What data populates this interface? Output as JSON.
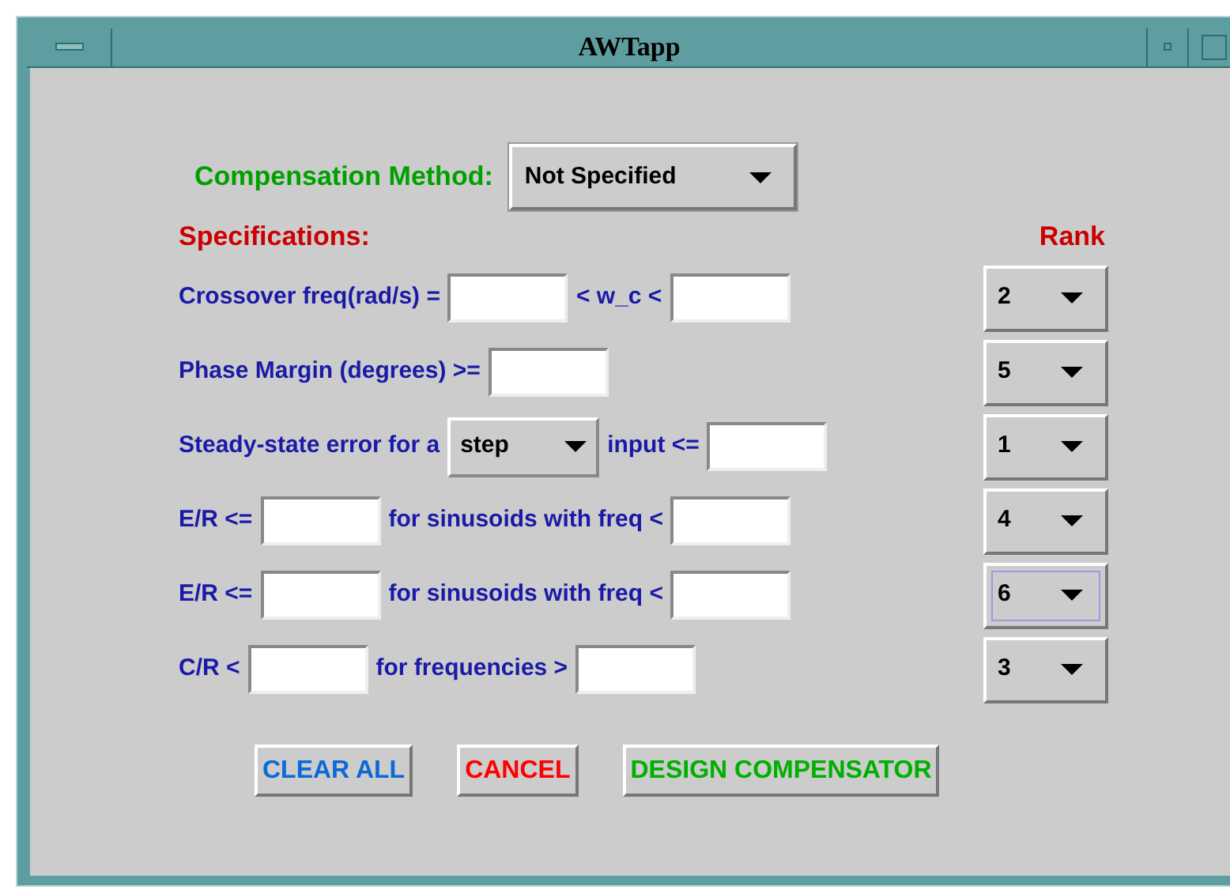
{
  "window": {
    "title": "AWTapp"
  },
  "compensation": {
    "label": "Compensation Method:",
    "value": "Not Specified"
  },
  "specifications_heading": "Specifications:",
  "rank_heading": "Rank",
  "rows": [
    {
      "parts": [
        {
          "kind": "text",
          "text": "Crossover freq(rad/s) ="
        },
        {
          "kind": "field"
        },
        {
          "kind": "text",
          "text": "< w_c <"
        },
        {
          "kind": "field"
        }
      ],
      "rank": {
        "value": "2",
        "focused": false
      }
    },
    {
      "parts": [
        {
          "kind": "text",
          "text": "Phase Margin (degrees) >="
        },
        {
          "kind": "field"
        }
      ],
      "rank": {
        "value": "5",
        "focused": false
      }
    },
    {
      "parts": [
        {
          "kind": "text",
          "text": "Steady-state error for a"
        },
        {
          "kind": "dropdown",
          "value": "step"
        },
        {
          "kind": "text",
          "text": "input <="
        },
        {
          "kind": "field"
        }
      ],
      "rank": {
        "value": "1",
        "focused": false
      }
    },
    {
      "parts": [
        {
          "kind": "text",
          "text": "E/R <="
        },
        {
          "kind": "field"
        },
        {
          "kind": "text",
          "text": "for sinusoids with freq <"
        },
        {
          "kind": "field"
        }
      ],
      "rank": {
        "value": "4",
        "focused": false
      }
    },
    {
      "parts": [
        {
          "kind": "text",
          "text": "E/R <="
        },
        {
          "kind": "field"
        },
        {
          "kind": "text",
          "text": "for sinusoids with freq <"
        },
        {
          "kind": "field"
        }
      ],
      "rank": {
        "value": "6",
        "focused": true
      }
    },
    {
      "parts": [
        {
          "kind": "text",
          "text": "C/R <"
        },
        {
          "kind": "field"
        },
        {
          "kind": "text",
          "text": "for frequencies >"
        },
        {
          "kind": "field"
        }
      ],
      "rank": {
        "value": "3",
        "focused": false
      }
    }
  ],
  "buttons": [
    {
      "label": "CLEAR ALL",
      "color": "#0a6ad8"
    },
    {
      "label": "CANCEL",
      "color": "#ff0000"
    },
    {
      "label": "DESIGN COMPENSATOR",
      "color": "#00b000"
    }
  ]
}
